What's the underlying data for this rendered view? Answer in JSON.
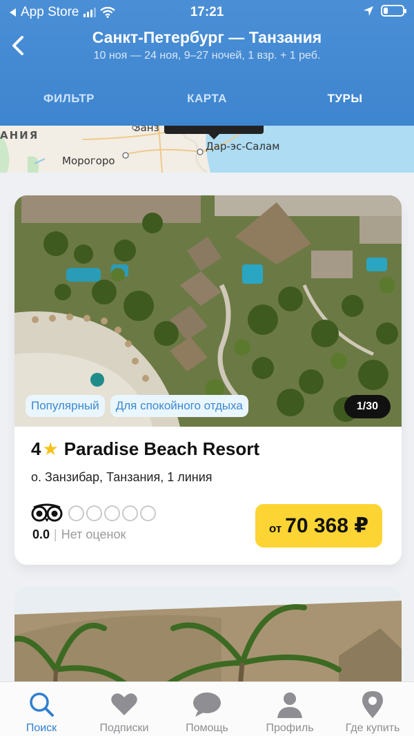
{
  "status_bar": {
    "back_app": "App Store",
    "time": "17:21"
  },
  "header": {
    "title": "Санкт-Петербург — Танзания",
    "subtitle": "10 ноя — 24 ноя, 9–27 ночей, 1 взр. + 1 реб.",
    "tabs": [
      {
        "label": "ФИЛЬТР",
        "active": false
      },
      {
        "label": "КАРТА",
        "active": false
      },
      {
        "label": "ТУРЫ",
        "active": true
      }
    ]
  },
  "map": {
    "labels": [
      "АНИЯ",
      "Занз",
      "Морогоро",
      "Дар-эс-Салам"
    ]
  },
  "hotel_card": {
    "tags": [
      "Популярный",
      "Для спокойного отдыха"
    ],
    "photo_counter": "1/30",
    "stars": "4",
    "name": "Paradise Beach Resort",
    "location": "о. Занзибар, Танзания, 1 линия",
    "rating_score": "0.0",
    "rating_separator": "|",
    "rating_text": "Нет оценок",
    "price_prefix": "от",
    "price": "70 368 ₽"
  },
  "tab_bar": {
    "items": [
      {
        "label": "Поиск",
        "icon": "search-icon",
        "active": true
      },
      {
        "label": "Подписки",
        "icon": "heart-icon",
        "active": false
      },
      {
        "label": "Помощь",
        "icon": "chat-bubble-icon",
        "active": false
      },
      {
        "label": "Профиль",
        "icon": "person-icon",
        "active": false
      },
      {
        "label": "Где купить",
        "icon": "location-pin-icon",
        "active": false
      }
    ]
  },
  "colors": {
    "header_blue": "#3e85cf",
    "accent_blue": "#2f7fce",
    "price_yellow": "#fcd534",
    "star_yellow": "#f7c21b",
    "tag_bg": "#eaf6fe",
    "tag_text": "#3a88cf"
  }
}
